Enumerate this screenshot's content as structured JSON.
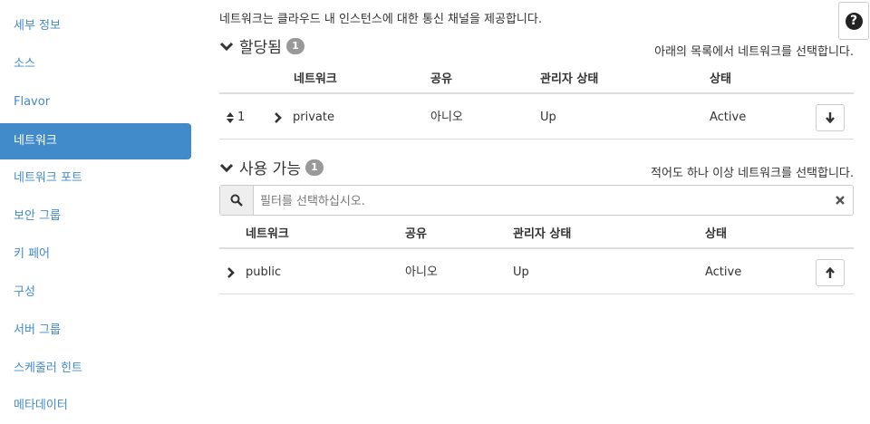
{
  "sidebar": {
    "items": [
      {
        "label": "세부 정보"
      },
      {
        "label": "소스"
      },
      {
        "label": "Flavor"
      },
      {
        "label": "네트워크"
      },
      {
        "label": "네트워크 포트"
      },
      {
        "label": "보안 그룹"
      },
      {
        "label": "키 페어"
      },
      {
        "label": "구성"
      },
      {
        "label": "서버 그룹"
      },
      {
        "label": "스케줄러 힌트"
      },
      {
        "label": "메타데이터"
      }
    ]
  },
  "main": {
    "intro": "네트워크는 클라우드 내 인스턴스에 대한 통신 채널을 제공합니다.",
    "allocated": {
      "title": "할당됨",
      "count": "1",
      "help": "아래의 목록에서 네트워크를 선택합니다.",
      "columns": [
        "네트워크",
        "공유",
        "관리자 상태",
        "상태"
      ],
      "rows": [
        {
          "order": "1",
          "name": "private",
          "shared": "아니오",
          "admin_state": "Up",
          "status": "Active"
        }
      ]
    },
    "available": {
      "title": "사용 가능",
      "count": "1",
      "help": "적어도 하나 이상 네트워크를 선택합니다.",
      "filter_placeholder": "필터를 선택하십시오.",
      "columns": [
        "네트워크",
        "공유",
        "관리자 상태",
        "상태"
      ],
      "rows": [
        {
          "name": "public",
          "shared": "아니오",
          "admin_state": "Up",
          "status": "Active"
        }
      ]
    }
  },
  "icons": {
    "help": "question-circle-icon",
    "expand": "chevron-down-icon",
    "row_expand": "chevron-right-icon",
    "reorder": "sort-icon",
    "deallocate": "arrow-down-icon",
    "allocate": "arrow-up-icon",
    "search": "search-icon",
    "clear": "close-icon"
  },
  "colors": {
    "accent": "#428bca",
    "badge": "#999999",
    "border": "#dddddd"
  }
}
